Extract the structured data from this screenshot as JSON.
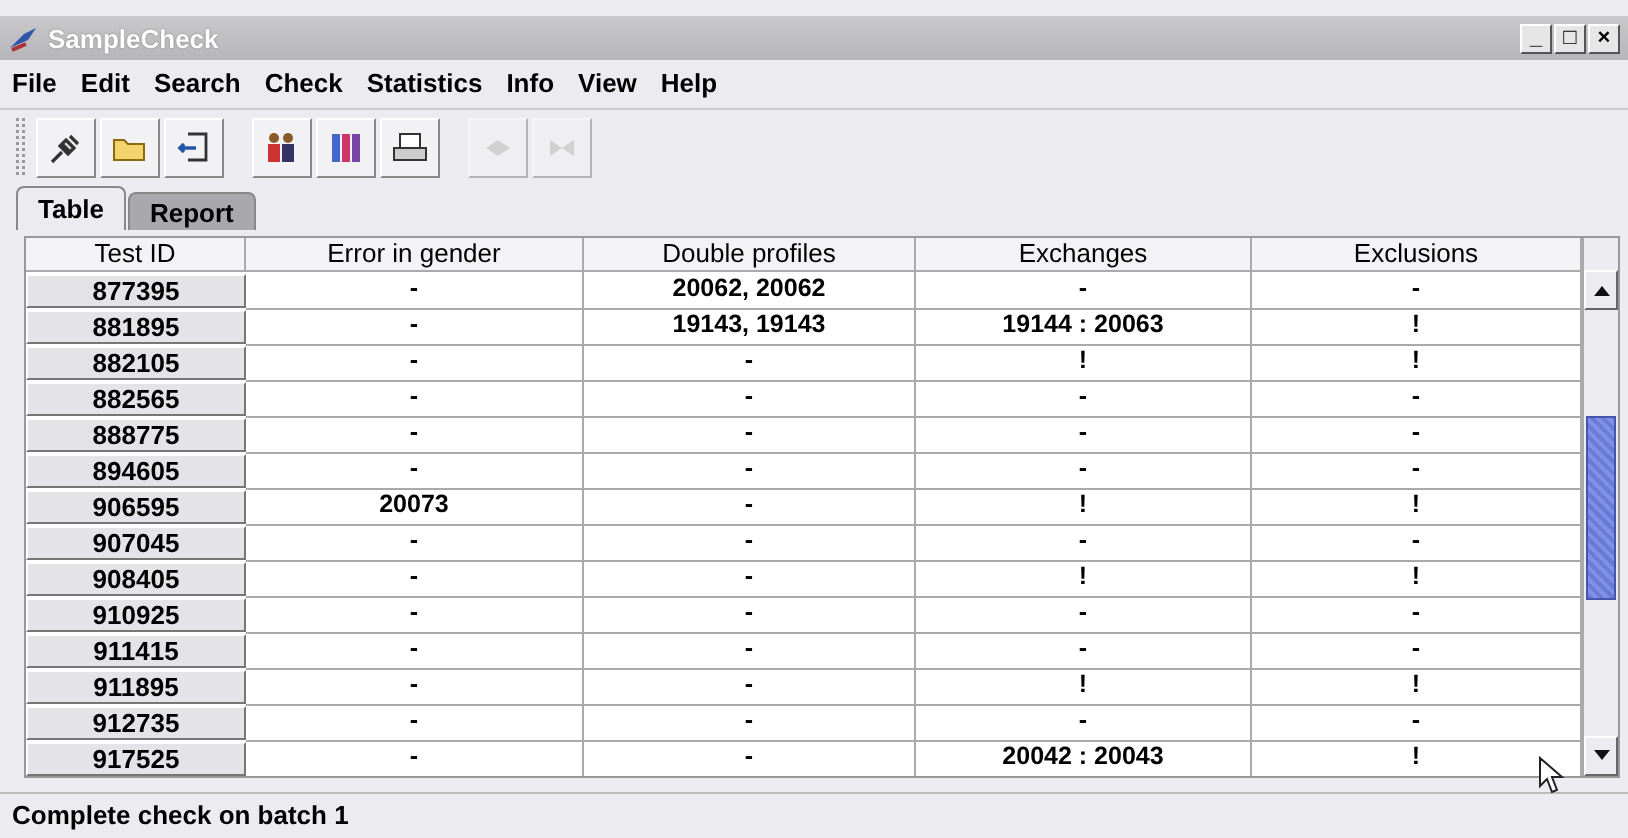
{
  "window": {
    "title": "SampleCheck",
    "controls": [
      "_",
      "□",
      "×"
    ]
  },
  "menu": [
    "File",
    "Edit",
    "Search",
    "Check",
    "Statistics",
    "Info",
    "View",
    "Help"
  ],
  "toolbar": [
    [
      {
        "kind": "plug",
        "disabled": false
      },
      {
        "kind": "folder",
        "disabled": false
      },
      {
        "kind": "exit",
        "disabled": false
      }
    ],
    [
      {
        "kind": "people",
        "disabled": false
      },
      {
        "kind": "tubes",
        "disabled": false
      },
      {
        "kind": "printer",
        "disabled": false
      }
    ],
    [
      {
        "kind": "diamond",
        "disabled": true
      },
      {
        "kind": "bowtie",
        "disabled": true
      }
    ]
  ],
  "tabs": [
    {
      "label": "Table",
      "selected": true
    },
    {
      "label": "Report",
      "selected": false
    }
  ],
  "table": {
    "columns": [
      "Test ID",
      "Error in gender",
      "Double profiles",
      "Exchanges",
      "Exclusions"
    ],
    "rows": [
      [
        "877395",
        "-",
        "20062, 20062",
        "-",
        "-"
      ],
      [
        "881895",
        "-",
        "19143, 19143",
        "19144 : 20063",
        "!"
      ],
      [
        "882105",
        "-",
        "-",
        "!",
        "!"
      ],
      [
        "882565",
        "-",
        "-",
        "-",
        "-"
      ],
      [
        "888775",
        "-",
        "-",
        "-",
        "-"
      ],
      [
        "894605",
        "-",
        "-",
        "-",
        "-"
      ],
      [
        "906595",
        "20073",
        "-",
        "!",
        "!"
      ],
      [
        "907045",
        "-",
        "-",
        "-",
        "-"
      ],
      [
        "908405",
        "-",
        "-",
        "!",
        "!"
      ],
      [
        "910925",
        "-",
        "-",
        "-",
        "-"
      ],
      [
        "911415",
        "-",
        "-",
        "-",
        "-"
      ],
      [
        "911895",
        "-",
        "-",
        "!",
        "!"
      ],
      [
        "912735",
        "-",
        "-",
        "-",
        "-"
      ],
      [
        "917525",
        "-",
        "-",
        "20042 : 20043",
        "!"
      ]
    ]
  },
  "status_bar": "Complete check on batch 1"
}
